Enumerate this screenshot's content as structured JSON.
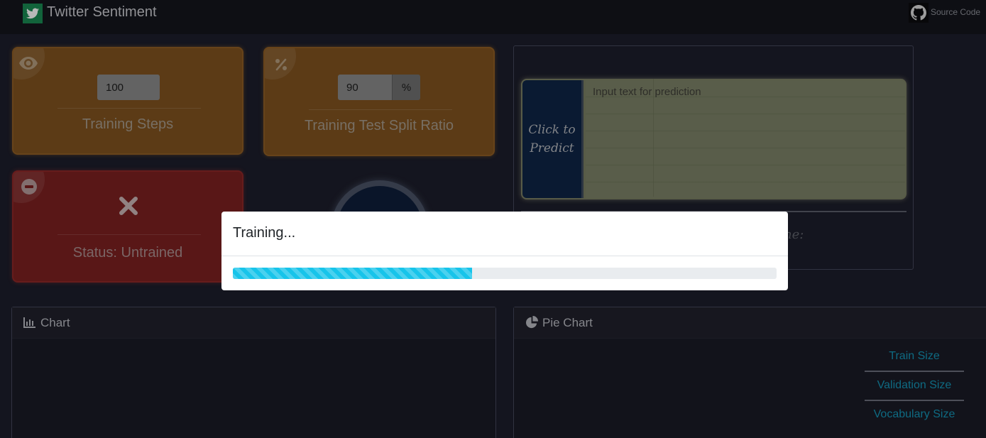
{
  "navbar": {
    "title": "Twitter Sentiment",
    "brand_icon": "twitter-bird-icon",
    "source_label": "Source Code",
    "source_icon": "github-icon"
  },
  "cards": {
    "steps": {
      "value": "100",
      "label": "Training Steps",
      "icon": "eye-icon"
    },
    "split": {
      "value": "90",
      "unit": "%",
      "label": "Training Test Split Ratio",
      "icon": "percent-icon"
    },
    "status": {
      "label": "Status: Untrained",
      "icon": "minus-circle-icon",
      "mark_icon": "x-icon"
    }
  },
  "predict": {
    "button_label": "Click to Predict",
    "placeholder": "Input text for prediction",
    "result_label": "ne:"
  },
  "panels": {
    "chart": {
      "title": "Chart",
      "icon": "bar-chart-icon"
    },
    "pie": {
      "title": "Pie Chart",
      "icon": "pie-chart-icon",
      "legend": [
        "Train Size",
        "Validation Size",
        "Vocabulary Size"
      ]
    }
  },
  "modal": {
    "title": "Training...",
    "progress": 0.44
  },
  "colors": {
    "accent_orange": "#80521f",
    "accent_red": "#7c2020",
    "progress": "#17c4ea",
    "legend_link": "#1494b5"
  }
}
